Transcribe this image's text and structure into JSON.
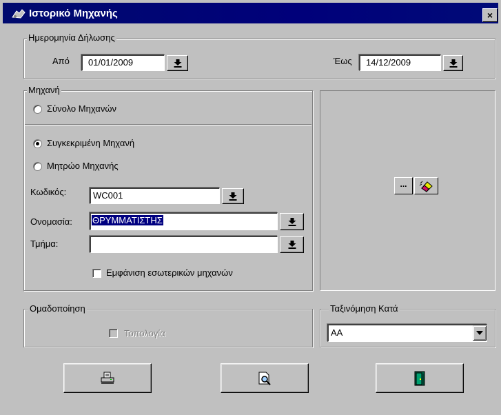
{
  "window": {
    "title": "Ιστορικό Μηχανής",
    "close_symbol": "×"
  },
  "date_group": {
    "legend": "Ημερομηνία Δήλωσης",
    "from_label": "Από",
    "from_value": "01/01/2009",
    "to_label": "Έως",
    "to_value": "14/12/2009"
  },
  "machine_group": {
    "legend": "Μηχανή",
    "radio_all": "Σύνολο Μηχανών",
    "radio_specific": "Συγκεκριμένη Μηχανή",
    "radio_registry": "Μητρώο Μηχανής",
    "selected_radio": "radio_specific",
    "code_label": "Κωδικός:",
    "code_value": "WC001",
    "name_label": "Ονομασία:",
    "name_value": "ΘΡΥΜΜΑΤΙΣΤΗΣ",
    "dept_label": "Τμήμα:",
    "dept_value": "",
    "show_internal_label": "Εμφάνιση εσωτερικών μηχανών",
    "show_internal_checked": false
  },
  "side_panel": {
    "browse_label": "...",
    "clear_icon": "eraser-icon"
  },
  "grouping_group": {
    "legend": "Ομαδοποίηση",
    "topology_label": "Τοπολογία",
    "topology_enabled": false
  },
  "sort_group": {
    "legend": "Ταξινόμηση Κατά",
    "selected_value": "ΑΑ"
  },
  "buttons": {
    "print_icon": "printer-icon",
    "preview_icon": "print-preview-icon",
    "exit_icon": "exit-door-icon"
  },
  "colors": {
    "titlebar": "#000a78",
    "face": "#c0c0c0",
    "selection": "#000080",
    "exit_icon": "#00a070"
  }
}
